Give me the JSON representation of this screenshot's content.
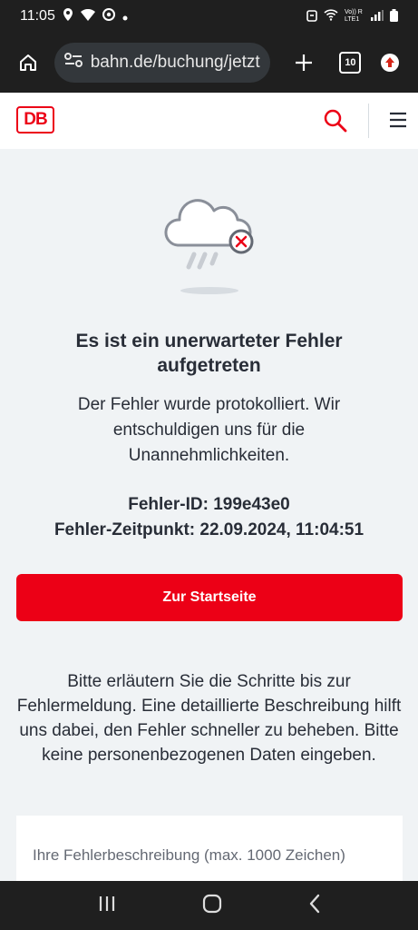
{
  "status_bar": {
    "time": "11:05",
    "network_label": "Vo)) R LTE1"
  },
  "browser": {
    "url": "bahn.de/buchung/jetzt",
    "tab_count": "10"
  },
  "site": {
    "logo_text": "DB"
  },
  "error": {
    "title": "Es ist ein unerwarteter Fehler aufgetreten",
    "description": "Der Fehler wurde protokolliert. Wir entschuldigen uns für die Unannehmlichkeiten.",
    "id_line": "Fehler-ID: 199e43e0",
    "time_line": "Fehler-Zeitpunkt: 22.09.2024, 11:04:51",
    "home_button": "Zur Startseite",
    "help_text": "Bitte erläutern Sie die Schritte bis zur Fehlermeldung. Eine detaillierte Beschreibung hilft uns dabei, den Fehler schneller zu beheben. Bitte keine personenbezogenen Daten eingeben.",
    "textarea_placeholder": "Ihre Fehlerbeschreibung (max. 1000 Zeichen)"
  },
  "colors": {
    "brand_red": "#ec0016",
    "page_bg": "#f0f3f5",
    "text": "#282d37"
  },
  "icons": [
    "home-icon",
    "site-settings-icon",
    "plus-icon",
    "tabs-icon",
    "update-icon",
    "search-icon",
    "menu-icon",
    "cloud-error-icon",
    "recents-icon",
    "home-nav-icon",
    "back-icon"
  ]
}
